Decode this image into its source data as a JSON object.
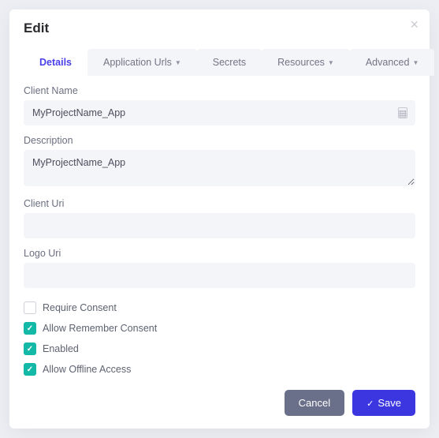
{
  "modal": {
    "title": "Edit"
  },
  "tabs": {
    "details": "Details",
    "urls": "Application Urls",
    "secrets": "Secrets",
    "resources": "Resources",
    "advanced": "Advanced"
  },
  "fields": {
    "clientName": {
      "label": "Client Name",
      "value": "MyProjectName_App"
    },
    "description": {
      "label": "Description",
      "value": "MyProjectName_App"
    },
    "clientUri": {
      "label": "Client Uri",
      "value": ""
    },
    "logoUri": {
      "label": "Logo Uri",
      "value": ""
    }
  },
  "checks": {
    "requireConsent": {
      "label": "Require Consent",
      "checked": false
    },
    "allowRemember": {
      "label": "Allow Remember Consent",
      "checked": true
    },
    "enabled": {
      "label": "Enabled",
      "checked": true
    },
    "allowOffline": {
      "label": "Allow Offline Access",
      "checked": true
    }
  },
  "buttons": {
    "cancel": "Cancel",
    "save": "Save"
  }
}
